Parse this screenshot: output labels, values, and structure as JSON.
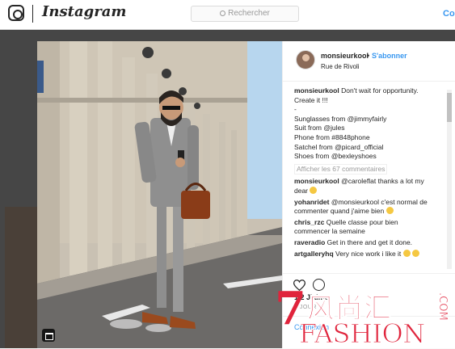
{
  "topbar": {
    "brand": "Instagram",
    "search_placeholder": "Rechercher",
    "login_label": "Co"
  },
  "post": {
    "username": "monsieurkool",
    "follow_label": "S'abonner",
    "location": "Rue de Rivoli",
    "caption_lines": [
      "Don't wait for opportunity.",
      "Create it !!!",
      "-",
      "Sunglasses from @jimmyfairly",
      "Suit from @jules",
      "Phone from #8848phone",
      "Satchel from @picard_official",
      "Shoes from @bexleyshoes"
    ],
    "more_comments": "Afficher les 67 commentaires",
    "comments": [
      {
        "user": "monsieurkool",
        "text_lines": [
          "@caroleflat thanks a lot my",
          "dear"
        ]
      },
      {
        "user": "yohanridet",
        "text_lines": [
          "@monsieurkool c'est normal de",
          "commenter quand j'aime bien"
        ]
      },
      {
        "user": "chris_rzc",
        "text_lines": [
          "Quelle classe pour bien",
          "commencer la semaine"
        ]
      },
      {
        "user": "raveradio",
        "text_lines": [
          "Get in there and get it done."
        ]
      },
      {
        "user": "artgalleryhq",
        "text_lines": [
          "Very nice work i like it"
        ]
      }
    ],
    "likes": "1 2 J'aime",
    "date": "4 JOUR",
    "login_text": "Connexion"
  },
  "watermark": {
    "digit": "7",
    "chinese": "风尚汇",
    "english": "FASHION",
    "domain": ".COM"
  },
  "colors": {
    "link": "#3897f0",
    "watermark": "#e0243c"
  }
}
